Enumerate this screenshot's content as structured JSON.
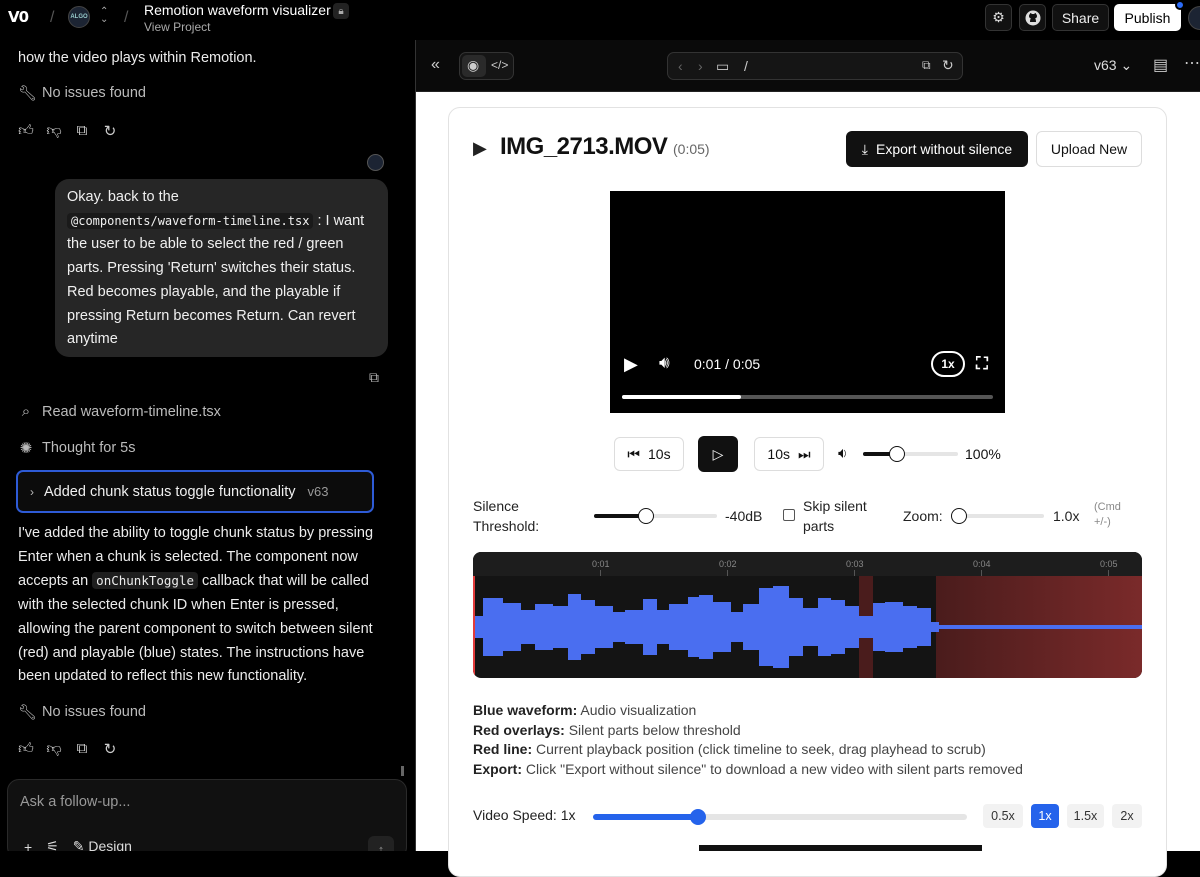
{
  "topbar": {
    "logo": "V0",
    "project_title": "Remotion waveform visualizer",
    "project_sub": "View Project",
    "share_label": "Share",
    "publish_label": "Publish"
  },
  "chat": {
    "prev_text_tail": "how the video plays within Remotion.",
    "issues_1": "No issues found",
    "user_message": {
      "line1": "Okay. back to the",
      "code": "@components/waveform-timeline.tsx",
      "line2": ": I want",
      "rest": [
        "the user to be able to select the red / green",
        "parts. Pressing 'Return' switches their status.",
        "Red becomes playable, and the playable if",
        "pressing Return becomes Return. Can revert",
        "anytime"
      ]
    },
    "read_file": "Read waveform-timeline.tsx",
    "thought": "Thought for 5s",
    "version_card": {
      "label": "Added chunk status toggle functionality",
      "version": "v63"
    },
    "reply": {
      "l1": "I've added the ability to toggle chunk status by pressing",
      "l2": "Enter when a chunk is selected. The component now",
      "l3a": "accepts an",
      "l3code": "onChunkToggle",
      "l3b": "callback that will be called",
      "l4": "with the selected chunk ID when Enter is pressed,",
      "l5": "allowing the parent component to switch between silent",
      "l6": "(red) and playable (blue) states. The instructions have",
      "l7": "been updated to reflect this new functionality."
    },
    "issues_2": "No issues found",
    "input_placeholder": "Ask a follow-up...",
    "design_label": "Design"
  },
  "preview": {
    "url_path": "/",
    "version": "v63",
    "file_name": "IMG_2713.MOV",
    "file_duration": "(0:05)",
    "export_label": "Export without silence",
    "upload_label": "Upload New",
    "video": {
      "time": "0:01 / 0:05",
      "speed": "1x",
      "progress": 0.32
    },
    "skip_back": "10s",
    "skip_fwd": "10s",
    "volume_pct": "100%",
    "volume_level": 0.36,
    "silence_label_1": "Silence",
    "silence_label_2": "Threshold:",
    "silence_value": "-40dB",
    "silence_level": 0.42,
    "skip_label_1": "Skip silent",
    "skip_label_2": "parts",
    "zoom_label": "Zoom:",
    "zoom_value": "1.0x",
    "zoom_hint_1": "(Cmd",
    "zoom_hint_2": "+/-)",
    "timeline_ticks": [
      "0:01",
      "0:02",
      "0:03",
      "0:04",
      "0:05"
    ],
    "legend": [
      {
        "key": "Blue waveform:",
        "text": "Audio visualization"
      },
      {
        "key": "Red overlays:",
        "text": "Silent parts below threshold"
      },
      {
        "key": "Red line:",
        "text": "Current playback position (click timeline to seek, drag playhead to scrub)"
      },
      {
        "key": "Export:",
        "text": "Click \"Export without silence\" to download a new video with silent parts removed"
      }
    ],
    "speed_label": "Video Speed: 1x",
    "speed_level": 0.28,
    "speed_options": [
      "0.5x",
      "1x",
      "1.5x",
      "2x"
    ],
    "speed_selected": "1x",
    "colors": {
      "accent": "#2563eb",
      "waveform": "#4a6ef0",
      "silence": "#5a1e1e"
    }
  }
}
